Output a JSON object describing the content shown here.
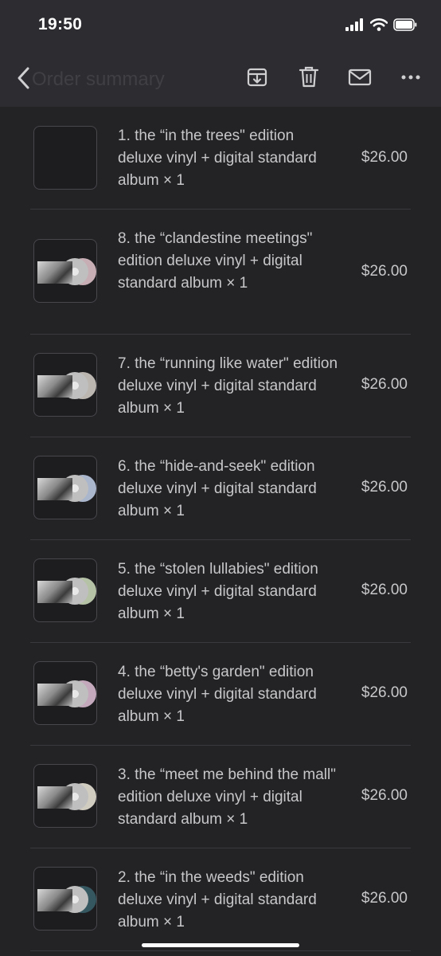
{
  "status": {
    "time": "19:50"
  },
  "appbar": {
    "title": "Order summary"
  },
  "icons": {
    "back": "chevron-left-icon",
    "archive": "archive-icon",
    "delete": "trash-icon",
    "mail": "mail-icon",
    "more": "more-horizontal-icon"
  },
  "order_items": [
    {
      "title": "1. the “in the trees\" edition deluxe vinyl + digital standard album × 1",
      "price": "$26.00",
      "disc_color": ""
    },
    {
      "title": "8. the “clandestine meetings\" edition deluxe vinyl + digital standard album × 1",
      "price": "$26.00",
      "disc_color": "#c7aeb4"
    },
    {
      "title": "7. the “running like water\" edition deluxe vinyl + digital standard album × 1",
      "price": "$26.00",
      "disc_color": "#bcb6b0"
    },
    {
      "title": "6. the “hide-and-seek\" edition deluxe vinyl + digital standard album × 1",
      "price": "$26.00",
      "disc_color": "#aab6cc"
    },
    {
      "title": "5. the “stolen lullabies\" edition deluxe vinyl + digital standard album × 1",
      "price": "$26.00",
      "disc_color": "#b6c2a6"
    },
    {
      "title": "4. the “betty's garden\" edition deluxe vinyl + digital standard album × 1",
      "price": "$26.00",
      "disc_color": "#c3a9bb"
    },
    {
      "title": "3. the “meet me behind the mall\" edition deluxe vinyl + digital standard album × 1",
      "price": "$26.00",
      "disc_color": "#d0ccc0"
    },
    {
      "title": "2. the “in the weeds\" edition deluxe vinyl + digital standard album × 1",
      "price": "$26.00",
      "disc_color": "#355760"
    }
  ]
}
